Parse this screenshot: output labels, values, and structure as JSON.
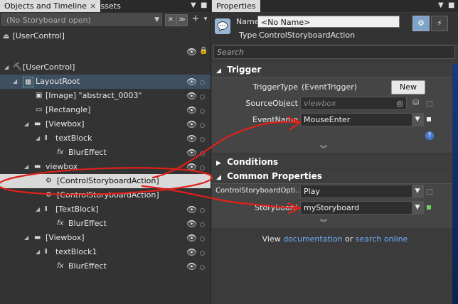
{
  "left": {
    "tabs": [
      {
        "label": "Objects and Timeline",
        "close": "×"
      },
      {
        "label": "Assets"
      }
    ],
    "storyboard_placeholder": "(No Storyboard open)",
    "top_usercontrol": "[UserControl]",
    "tree": [
      {
        "label": "[UserControl]"
      },
      {
        "label": "LayoutRoot"
      },
      {
        "label": "[Image] \"abstract_0003\""
      },
      {
        "label": "[Rectangle]"
      },
      {
        "label": "[Viewbox]"
      },
      {
        "label": "textBlock"
      },
      {
        "label": "BlurEffect",
        "prefix": "fx"
      },
      {
        "label": "viewbox"
      },
      {
        "label": "[ControlStoryboardAction]"
      },
      {
        "label": "[ControlStoryboardAction]"
      },
      {
        "label": "[TextBlock]"
      },
      {
        "label": "BlurEffect",
        "prefix": "fx"
      },
      {
        "label": "[Viewbox]"
      },
      {
        "label": "textBlock1"
      },
      {
        "label": "BlurEffect",
        "prefix": "fx"
      }
    ]
  },
  "right": {
    "tab": "Properties",
    "name_label": "Name",
    "name_value": "<No Name>",
    "type_label": "Type",
    "type_value": "ControlStoryboardAction",
    "search_placeholder": "Search",
    "trigger": {
      "header": "Trigger",
      "trigger_type_label": "TriggerType",
      "trigger_type_value": "(EventTrigger)",
      "new_button": "New",
      "source_object_label": "SourceObject",
      "source_object_value": "viewbox",
      "event_name_label": "EventName",
      "event_name_value": "MouseEnter"
    },
    "conditions_header": "Conditions",
    "common": {
      "header": "Common Properties",
      "cso_label": "ControlStoryboardOpti...",
      "cso_value": "Play",
      "storyboard_label": "Storyboard",
      "storyboard_value": "myStoryboard"
    },
    "footer": {
      "view": "View",
      "documentation": "documentation",
      "or": "or",
      "search_online": "search online"
    }
  },
  "colors": {
    "annotation": "#e0201a",
    "link": "#6fb2ff",
    "accent_green": "#6bd16b"
  }
}
